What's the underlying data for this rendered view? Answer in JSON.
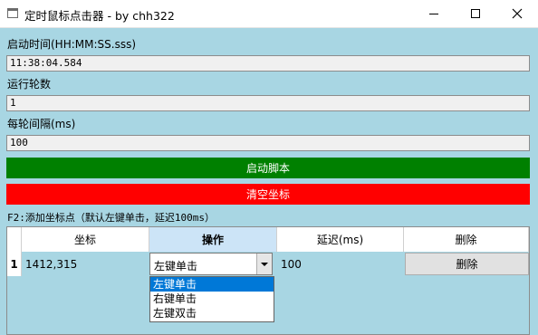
{
  "window": {
    "title": "定时鼠标点击器 - by chh322"
  },
  "form": {
    "start_time_label": "启动时间(HH:MM:SS.sss)",
    "start_time_value": "11:38:04.584",
    "rounds_label": "运行轮数",
    "rounds_value": "1",
    "interval_label": "每轮间隔(ms)",
    "interval_value": "100"
  },
  "buttons": {
    "start": "启动脚本",
    "clear": "清空坐标",
    "start_color": "#008000",
    "clear_color": "#ff0000"
  },
  "hint": "F2:添加坐标点（默认左键单击，延迟100ms）",
  "table": {
    "columns": [
      "坐标",
      "操作",
      "延迟(ms)",
      "删除"
    ],
    "selected_column": "操作",
    "rows": [
      {
        "index": "1",
        "coordinate": "1412,315",
        "action": "左键单击",
        "delay": "100",
        "delete_label": "删除"
      }
    ]
  },
  "action_dropdown": {
    "options": [
      "左键单击",
      "右键单击",
      "左键双击"
    ],
    "highlighted": "左键单击"
  }
}
